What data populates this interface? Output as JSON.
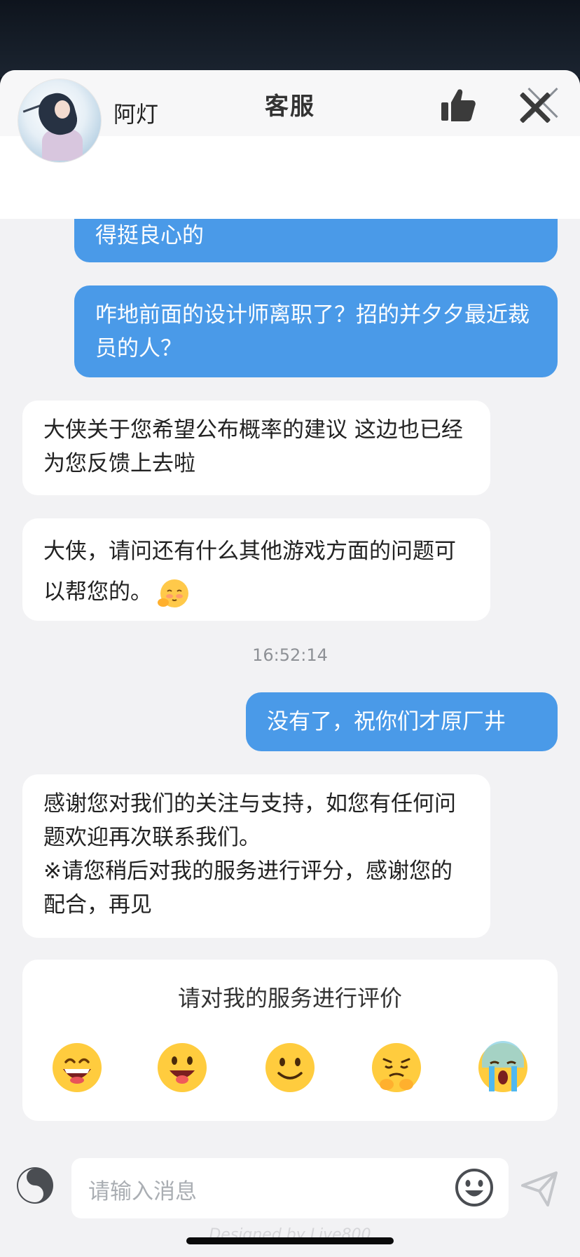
{
  "window": {
    "title": "客服"
  },
  "agent": {
    "name": "阿灯"
  },
  "messages": {
    "m1": "得挺良心的",
    "m2": "咋地前面的设计师离职了？招的并夕夕最近裁员的人？",
    "m3": "大侠关于您希望公布概率的建议 这边也已经为您反馈上去啦",
    "m4": "大侠，请问还有什么其他游戏方面的问题可以帮您的。",
    "timestamp": "16:52:14",
    "m5": "没有了，祝你们才原厂井",
    "m6": "感谢您对我们的关注与支持，如您有任何问题欢迎再次联系我们。\n※请您稍后对我的服务进行评分，感谢您的配合，再见"
  },
  "rating": {
    "title": "请对我的服务进行评价",
    "options": [
      "grin-icon",
      "smile-tongue-icon",
      "slight-smile-icon",
      "pleading-icon",
      "crying-icon"
    ]
  },
  "composer": {
    "placeholder": "请输入消息"
  },
  "footer": {
    "watermark": "Designed by Live800"
  },
  "colors": {
    "accent": "#4a9ae8",
    "background": "#f2f2f4"
  }
}
